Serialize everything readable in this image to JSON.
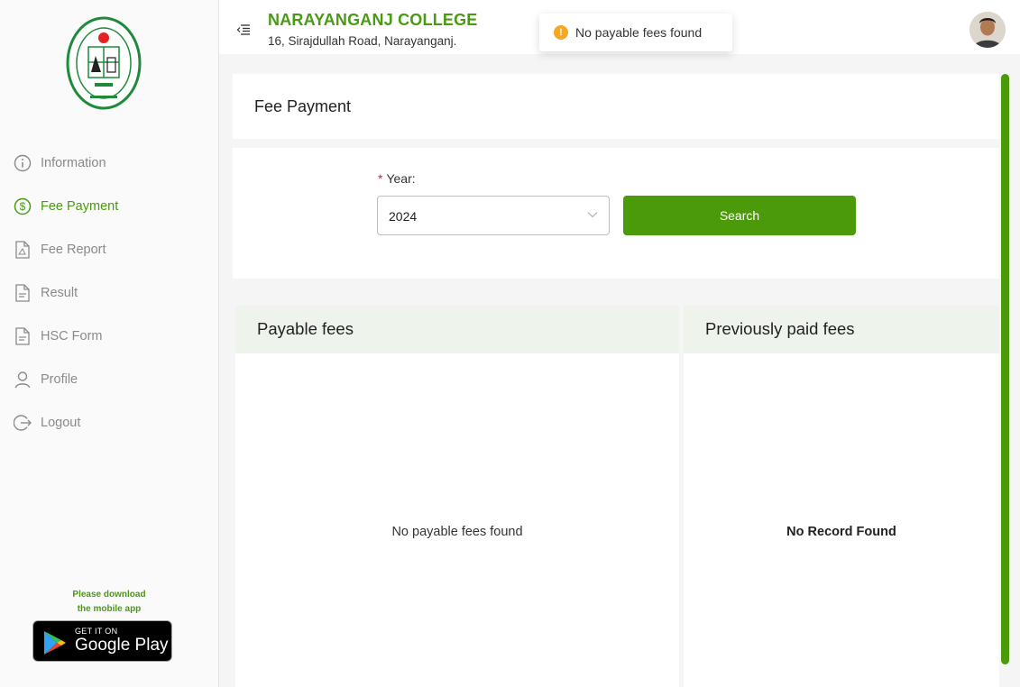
{
  "college": {
    "name": "NARAYANGANJ COLLEGE",
    "address": "16, Sirajdullah Road, Narayanganj."
  },
  "toast": {
    "message": "No payable fees found",
    "icon": "warning-icon"
  },
  "sidebar": {
    "items": [
      {
        "label": "Information",
        "icon": "info-icon"
      },
      {
        "label": "Fee Payment",
        "icon": "dollar-icon",
        "active": true
      },
      {
        "label": "Fee Report",
        "icon": "pdf-file-icon"
      },
      {
        "label": "Result",
        "icon": "document-icon"
      },
      {
        "label": "HSC Form",
        "icon": "document-icon"
      },
      {
        "label": "Profile",
        "icon": "user-icon"
      },
      {
        "label": "Logout",
        "icon": "logout-icon"
      }
    ],
    "download_line1": "Please download",
    "download_line2": "the mobile app",
    "gplay_top": "GET IT ON",
    "gplay_main": "Google Play"
  },
  "page": {
    "title": "Fee Payment",
    "year_label": "Year:",
    "year_required_mark": "*",
    "year_value": "2024",
    "search_label": "Search"
  },
  "panels": {
    "payable_title": "Payable fees",
    "payable_empty": "No payable fees found",
    "paid_title": "Previously paid fees",
    "paid_empty": "No Record Found"
  },
  "colors": {
    "brand_green": "#4a9a0a",
    "warning": "#f5a623",
    "panel_header_bg": "#eef3ec"
  }
}
